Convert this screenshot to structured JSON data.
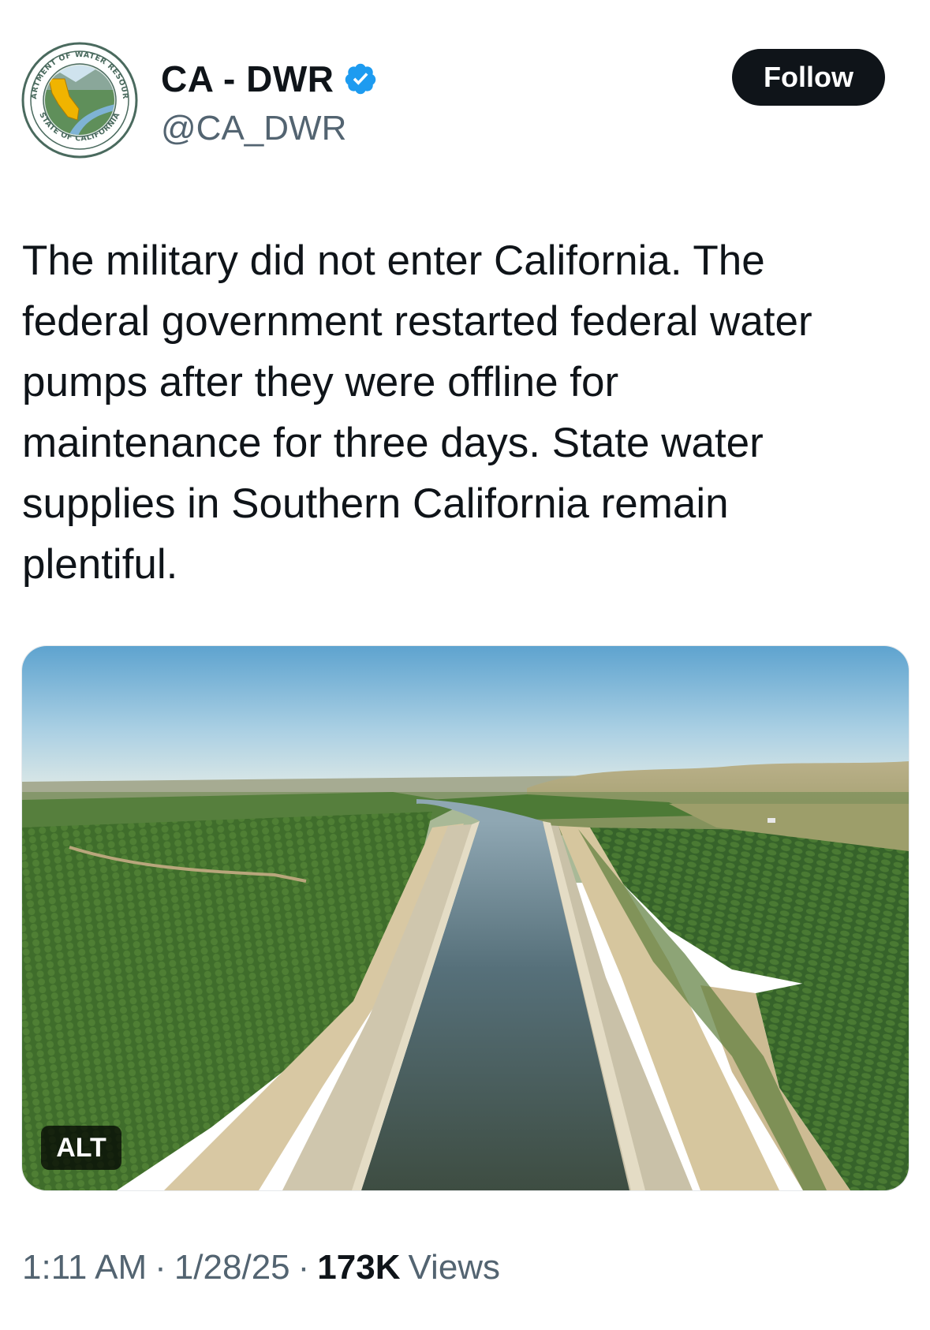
{
  "tweet": {
    "author": {
      "display_name": "CA - DWR",
      "handle": "@CA_DWR",
      "verified": true,
      "avatar_icon": "dwr-seal-icon",
      "avatar_seal_text_top": "DEPARTMENT OF WATER RESOURCES",
      "avatar_seal_text_bottom": "STATE OF CALIFORNIA"
    },
    "follow_label": "Follow",
    "text": "The military did not enter California. The\nfederal government restarted federal water\npumps after they were offline for\nmaintenance for three days. State water\nsupplies in Southern California remain\nplentiful.",
    "media": {
      "alt_label": "ALT"
    },
    "meta": {
      "time": "1:11 AM",
      "separator": "·",
      "date": "1/28/25",
      "views_count": "173K",
      "views_label": "Views"
    }
  },
  "colors": {
    "text": "#0f1419",
    "secondary": "#536471",
    "verified_blue": "#1d9bf0",
    "button_bg": "#0f1419"
  }
}
